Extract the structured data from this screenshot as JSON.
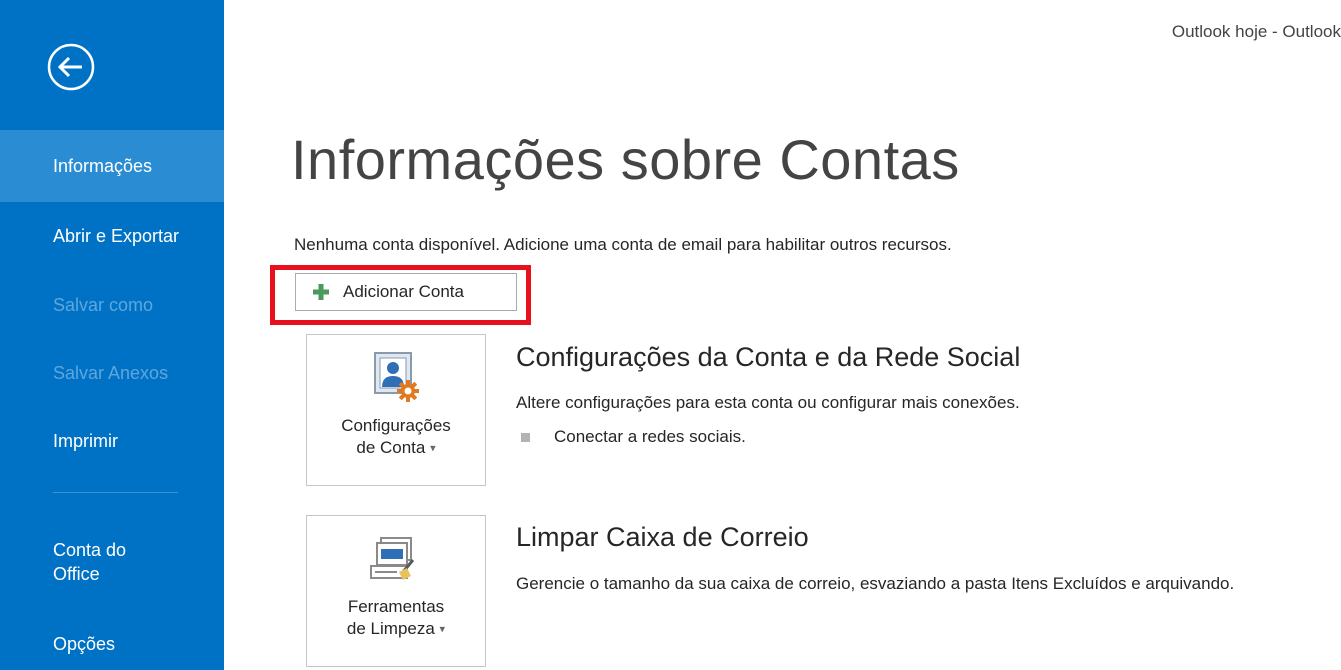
{
  "window": {
    "title": "Outlook hoje - Outlook"
  },
  "sidebar": {
    "back_icon": "back-arrow-circle-icon",
    "items": [
      {
        "label": "Informações",
        "state": "active"
      },
      {
        "label": "Abrir e Exportar",
        "state": "enabled"
      },
      {
        "label": "Salvar como",
        "state": "disabled"
      },
      {
        "label": "Salvar Anexos",
        "state": "disabled"
      },
      {
        "label": "Imprimir",
        "state": "enabled"
      },
      {
        "label_line1": "Conta do",
        "label_line2": "Office",
        "state": "enabled"
      },
      {
        "label": "Opções",
        "state": "enabled"
      }
    ]
  },
  "main": {
    "title": "Informações sobre Contas",
    "notice": "Nenhuma conta disponível. Adicione uma conta de email para habilitar outros recursos.",
    "add_account": {
      "label": "Adicionar Conta",
      "icon": "plus-icon",
      "highlighted": true
    },
    "sections": [
      {
        "tile_line1": "Configurações",
        "tile_line2": "de Conta",
        "tile_icon": "account-settings-icon",
        "title": "Configurações da Conta e da Rede Social",
        "description": "Altere configurações para esta conta ou configurar mais conexões.",
        "bullet": "Conectar a redes sociais."
      },
      {
        "tile_line1": "Ferramentas",
        "tile_line2": "de Limpeza",
        "tile_icon": "cleanup-tools-icon",
        "title": "Limpar Caixa de Correio",
        "description": "Gerencie o tamanho da sua caixa de correio, esvaziando a pasta Itens Excluídos e arquivando."
      }
    ]
  },
  "colors": {
    "sidebar_bg": "#0072c6",
    "sidebar_active": "#2a8dd4",
    "sidebar_disabled_text": "#5ea6dc",
    "highlight_border": "#e8101d",
    "plus_green": "#4a9a5a"
  }
}
